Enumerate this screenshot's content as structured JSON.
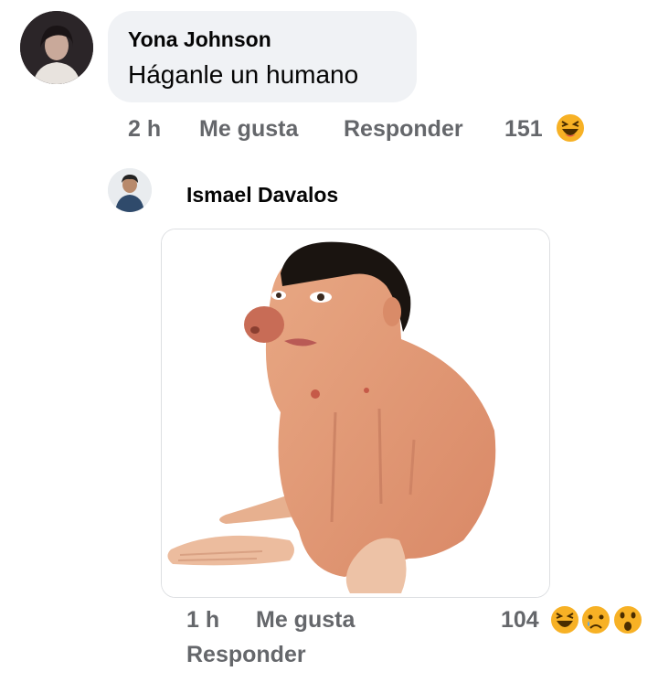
{
  "comment": {
    "author": "Yona Johnson",
    "text": "Háganle un humano",
    "time": "2 h",
    "like_label": "Me gusta",
    "reply_label": "Responder",
    "reaction_count": "151",
    "reactions": [
      "laughing-emoji"
    ]
  },
  "reply": {
    "author": "Ismael Davalos",
    "time": "1 h",
    "like_label": "Me gusta",
    "reply_label": "Responder",
    "reaction_count": "104",
    "reactions": [
      "laughing-emoji",
      "sad-emoji",
      "wow-emoji"
    ]
  },
  "colors": {
    "bubble": "#f0f2f5",
    "meta_text": "#65676b",
    "emoji_yellow": "#f7b125"
  }
}
